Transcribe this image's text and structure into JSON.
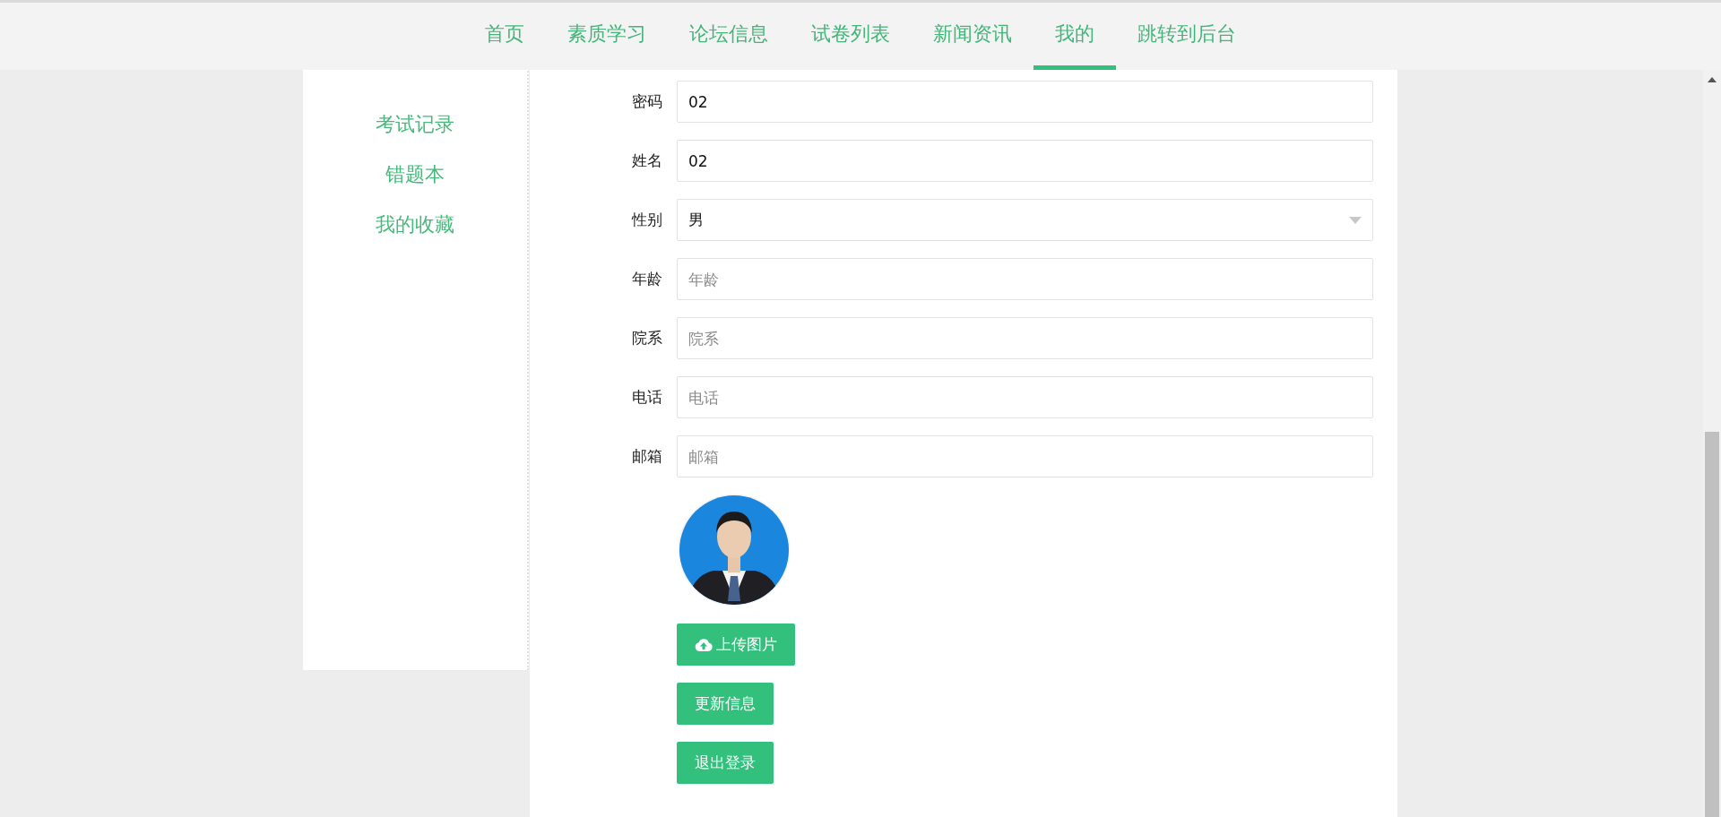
{
  "nav": [
    {
      "label": "首页",
      "selected": false
    },
    {
      "label": "素质学习",
      "selected": false
    },
    {
      "label": "论坛信息",
      "selected": false
    },
    {
      "label": "试卷列表",
      "selected": false
    },
    {
      "label": "新闻资讯",
      "selected": false
    },
    {
      "label": "我的",
      "selected": true
    },
    {
      "label": "跳转到后台",
      "selected": false
    }
  ],
  "sidebar": {
    "items": [
      "考试记录",
      "错题本",
      "我的收藏"
    ]
  },
  "form": {
    "fields": [
      {
        "label": "密码",
        "kind": "text",
        "value": "02"
      },
      {
        "label": "姓名",
        "kind": "text",
        "value": "02"
      },
      {
        "label": "性别",
        "kind": "select",
        "value": "男"
      },
      {
        "label": "年龄",
        "kind": "text",
        "placeholder": "年龄"
      },
      {
        "label": "院系",
        "kind": "text",
        "placeholder": "院系"
      },
      {
        "label": "电话",
        "kind": "text",
        "placeholder": "电话"
      },
      {
        "label": "邮箱",
        "kind": "text",
        "placeholder": "邮箱"
      }
    ],
    "buttons": [
      {
        "label": "上传图片",
        "kind": "upload"
      },
      {
        "label": "更新信息",
        "kind": "plain"
      },
      {
        "label": "退出登录",
        "kind": "plain"
      }
    ]
  }
}
